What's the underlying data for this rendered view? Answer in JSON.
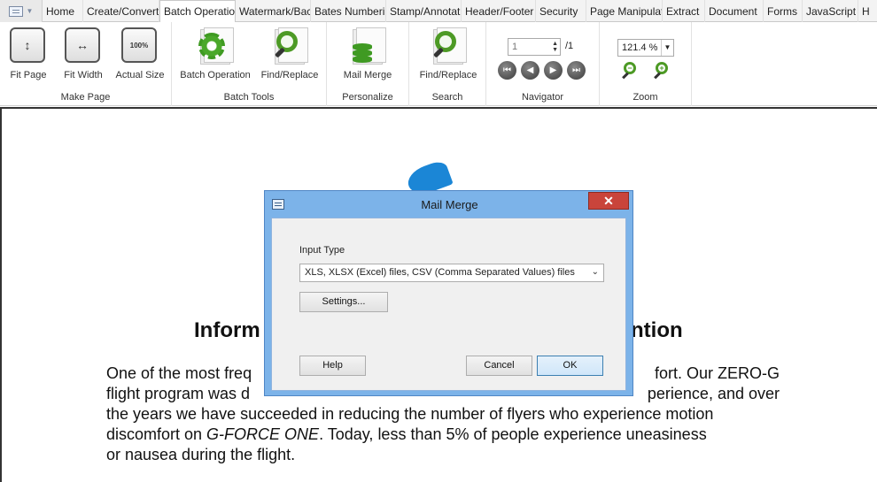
{
  "tabs": [
    {
      "label": "Home"
    },
    {
      "label": "Create/Convert"
    },
    {
      "label": "Batch Operatio",
      "active": true
    },
    {
      "label": "Watermark/Bac"
    },
    {
      "label": "Bates Numberi"
    },
    {
      "label": "Stamp/Annotat"
    },
    {
      "label": "Header/Footer"
    },
    {
      "label": "Security"
    },
    {
      "label": "Page Manipulat"
    },
    {
      "label": "Extract"
    },
    {
      "label": "Document"
    },
    {
      "label": "Forms"
    },
    {
      "label": "JavaScript"
    },
    {
      "label": "H"
    }
  ],
  "ribbon": {
    "make_page": {
      "label": "Make Page",
      "fit_page": "Fit Page",
      "fit_width": "Fit Width",
      "actual_size": "Actual Size",
      "actual_size_icon_text": "100%"
    },
    "batch_tools": {
      "label": "Batch Tools",
      "batch_operation": "Batch Operation",
      "find_replace": "Find/Replace"
    },
    "personalize": {
      "label": "Personalize",
      "mail_merge": "Mail Merge"
    },
    "search": {
      "label": "Search",
      "find_replace": "Find/Replace"
    },
    "navigator": {
      "label": "Navigator",
      "page_value": "1",
      "page_total": "/1"
    },
    "zoom": {
      "label": "Zoom",
      "value": "121.4 %"
    }
  },
  "document": {
    "heading_left": "Inform",
    "heading_right": "ntion",
    "lines": [
      {
        "left": "One of the most freq",
        "right": "fort.  Our ZERO-G"
      },
      {
        "left": "flight program was d",
        "right": "perience, and over"
      },
      {
        "full": "the years we have succeeded in reducing the number of flyers who experience motion"
      },
      {
        "a": "discomfort on ",
        "em": "G-FORCE ONE",
        "b": ". Today, less than 5% of people experience uneasiness"
      },
      {
        "full": "or nausea during the flight."
      }
    ]
  },
  "dialog": {
    "title": "Mail Merge",
    "input_type_label": "Input Type",
    "input_type_value": "XLS, XLSX (Excel) files, CSV (Comma Separated Values) files",
    "settings_button": "Settings...",
    "help_button": "Help",
    "cancel_button": "Cancel",
    "ok_button": "OK"
  },
  "colors": {
    "dialog_frame": "#7cb3e9",
    "close_button": "#c9443b",
    "icon_green": "#4d9a25",
    "logo_blue": "#1b86d6"
  }
}
